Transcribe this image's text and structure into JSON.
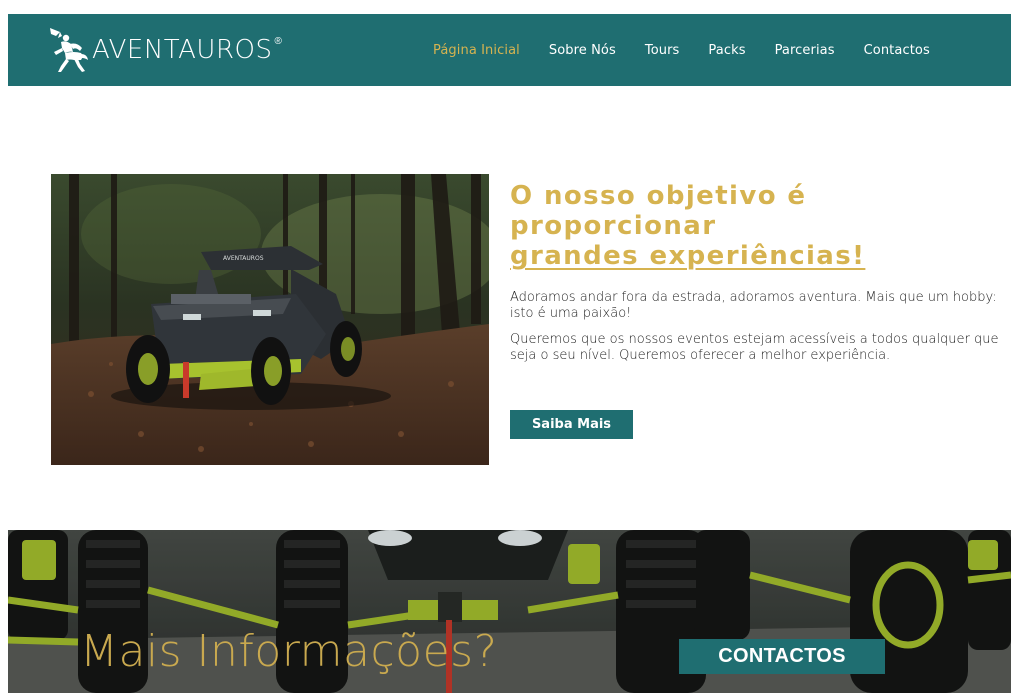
{
  "brand": {
    "name": "AVENTAUROS",
    "registered_mark": "®",
    "icon": "centaur-logo-icon"
  },
  "nav": {
    "items": [
      {
        "label": "Página Inicial",
        "active": true
      },
      {
        "label": "Sobre Nós",
        "active": false
      },
      {
        "label": "Tours",
        "active": false
      },
      {
        "label": "Packs",
        "active": false
      },
      {
        "label": "Parcerias",
        "active": false
      },
      {
        "label": "Contactos",
        "active": false
      }
    ]
  },
  "hero": {
    "headline_line1": "O nosso objetivo é proporcionar",
    "headline_line2": "grandes experiências!",
    "paragraph1": "Adoramos andar fora da estrada, adoramos aventura. Mais que um hobby: isto é uma paixão!",
    "paragraph2": "Queremos que os nossos eventos estejam acessíveis a todos qualquer que seja o seu nível. Queremos oferecer a melhor experiência.",
    "cta_label": "Saiba Mais",
    "image": "utv-buggy-in-forest-photo",
    "vehicle_text": "AVENTAUROS"
  },
  "banner": {
    "title": "Mais Informações?",
    "button_label": "CONTACTOS",
    "image": "utv-front-wheels-photo"
  },
  "colors": {
    "teal": "#1f6e71",
    "gold": "#d6b350",
    "text": "#222222",
    "white": "#ffffff"
  }
}
